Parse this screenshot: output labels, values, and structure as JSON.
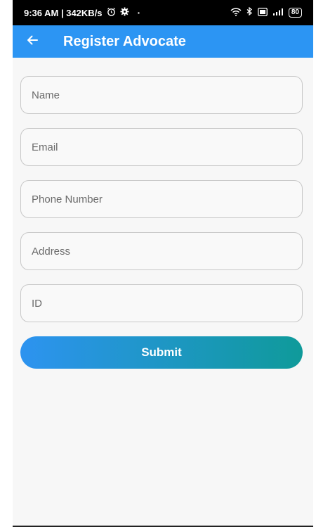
{
  "status_bar": {
    "time_speed": "9:36 AM | 342KB/s",
    "battery": "80"
  },
  "app_bar": {
    "title": "Register Advocate"
  },
  "form": {
    "fields": [
      {
        "placeholder": "Name",
        "value": ""
      },
      {
        "placeholder": "Email",
        "value": ""
      },
      {
        "placeholder": "Phone Number",
        "value": ""
      },
      {
        "placeholder": "Address",
        "value": ""
      },
      {
        "placeholder": "ID",
        "value": ""
      }
    ],
    "submit_label": "Submit"
  },
  "colors": {
    "app_bar": "#2c95f3",
    "gradient_start": "#2d93f0",
    "gradient_end": "#0f9a9a"
  }
}
